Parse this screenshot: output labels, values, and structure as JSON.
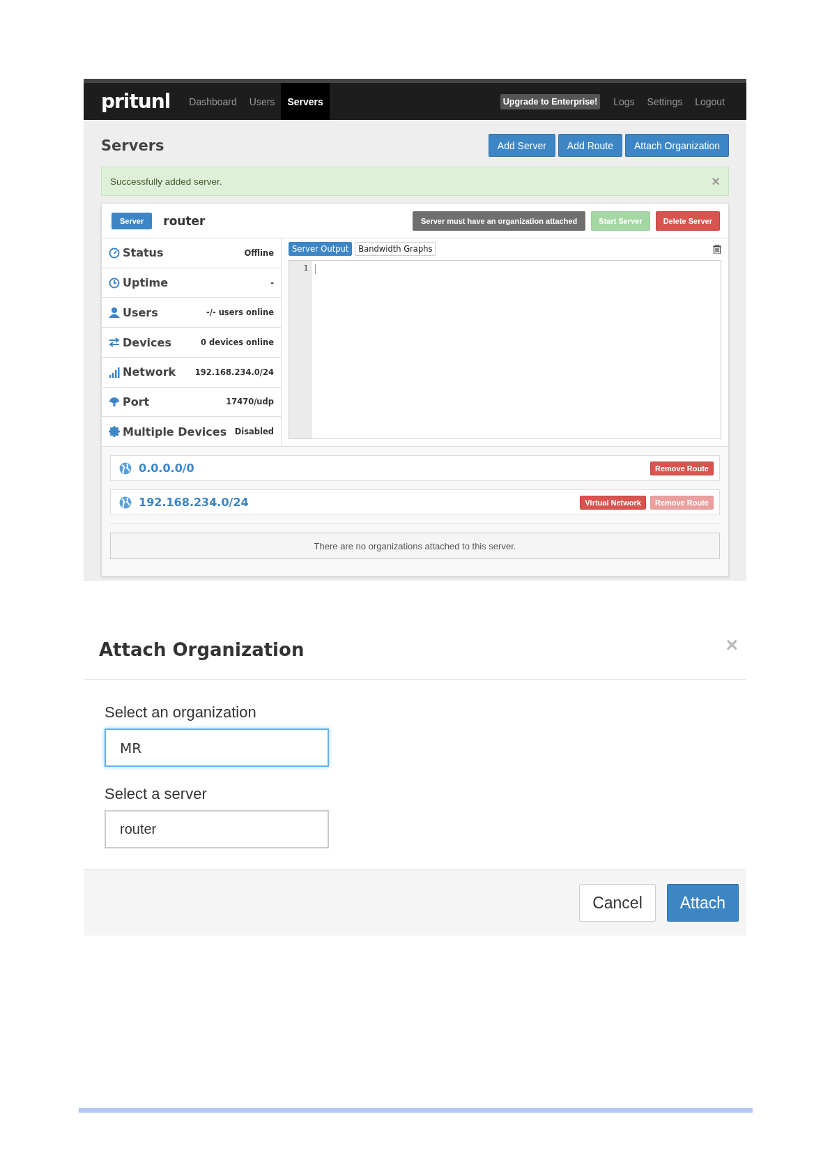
{
  "nav": {
    "logo": "pritunl",
    "items": [
      {
        "label": "Dashboard",
        "selected": false
      },
      {
        "label": "Users",
        "selected": false
      },
      {
        "label": "Servers",
        "selected": true
      }
    ],
    "upgrade": "Upgrade to Enterprise!",
    "right_items": [
      "Logs",
      "Settings",
      "Logout"
    ]
  },
  "page_title": "Servers",
  "actions": [
    "Add Server",
    "Add Route",
    "Attach Organization"
  ],
  "alert": {
    "text": "Successfully added server.",
    "close": "×"
  },
  "server": {
    "badge": "Server",
    "name": "router",
    "status_message": "Server must have an organization attached",
    "buttons": [
      {
        "label": "Start Server",
        "kind": "start",
        "disabled": true
      },
      {
        "label": "Delete Server",
        "kind": "delete",
        "disabled": false
      }
    ],
    "info": [
      {
        "label": "Status",
        "value": "Offline"
      },
      {
        "label": "Uptime",
        "value": "-"
      },
      {
        "label": "Users",
        "value": "-/- users online"
      },
      {
        "label": "Devices",
        "value": "0 devices online"
      },
      {
        "label": "Network",
        "value": "192.168.234.0/24"
      },
      {
        "label": "Port",
        "value": "17470/udp"
      },
      {
        "label": "Multiple Devices",
        "value": "Disabled"
      }
    ],
    "output_tabs": [
      {
        "label": "Server Output",
        "selected": true
      },
      {
        "label": "Bandwidth Graphs",
        "selected": false
      }
    ],
    "line_numbers": [
      "1"
    ],
    "routes": [
      {
        "network": "0.0.0.0/0",
        "buttons": [
          {
            "label": "Remove Route",
            "disabled": false
          }
        ]
      },
      {
        "network": "192.168.234.0/24",
        "buttons": [
          {
            "label": "Virtual Network",
            "disabled": false
          },
          {
            "label": "Remove Route",
            "disabled": true
          }
        ]
      }
    ],
    "empty_message": "There are no organizations attached to this server."
  },
  "modal": {
    "title": "Attach Organization",
    "close": "×",
    "fields": [
      {
        "label": "Select an organization",
        "value": "MR",
        "focused": true
      },
      {
        "label": "Select a server",
        "value": "router",
        "focused": false
      }
    ],
    "buttons": [
      {
        "label": "Cancel",
        "kind": "default"
      },
      {
        "label": "Attach",
        "kind": "primary"
      }
    ]
  }
}
